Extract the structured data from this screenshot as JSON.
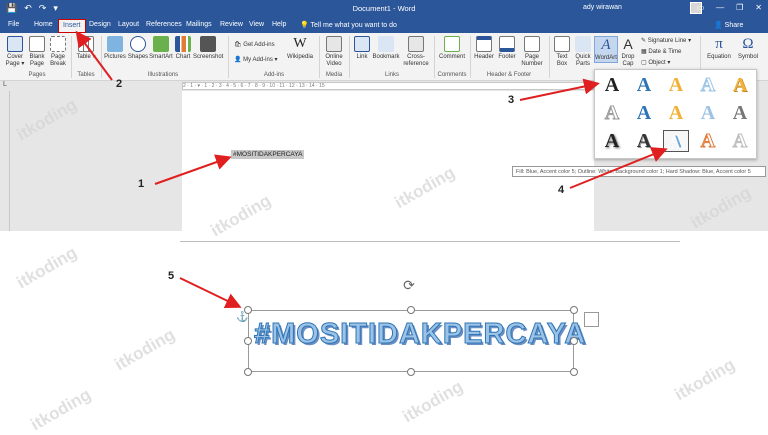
{
  "titlebar": {
    "quick_access": [
      "💾",
      "↶",
      "↷",
      "▾"
    ],
    "document_title": "Document1 - Word",
    "user_name": "ady wirawan",
    "controls": [
      "▭",
      "—",
      "❐",
      "✕"
    ]
  },
  "tabs": [
    {
      "label": "File"
    },
    {
      "label": "Home"
    },
    {
      "label": "Insert"
    },
    {
      "label": "Design"
    },
    {
      "label": "Layout"
    },
    {
      "label": "References"
    },
    {
      "label": "Mailings"
    },
    {
      "label": "Review"
    },
    {
      "label": "View"
    },
    {
      "label": "Help"
    }
  ],
  "tell_me": "Tell me what you want to do",
  "share_label": "Share",
  "ribbon": {
    "cover_page": "Cover Page ▾",
    "blank_page": "Blank Page",
    "page_break": "Page Break",
    "table": "Table ▾",
    "pictures": "Pictures",
    "shapes": "Shapes",
    "smartart": "SmartArt",
    "chart": "Chart",
    "screenshot": "Screenshot",
    "get_addins": "Get Add-ins",
    "my_addins": "My Add-ins",
    "wikipedia": "Wikipedia",
    "online_video": "Online Video",
    "link": "Link",
    "bookmark": "Bookmark",
    "cross_reference": "Cross-reference",
    "comment": "Comment",
    "header": "Header",
    "footer": "Footer",
    "page_number": "Page Number",
    "text_box": "Text Box",
    "quick_parts": "Quick Parts",
    "wordart": "WordArt",
    "drop_cap": "Drop Cap",
    "signature_line": "Signature Line",
    "date_time": "Date & Time",
    "object": "Object",
    "equation": "Equation",
    "symbol": "Symbol",
    "groups": {
      "pages": "Pages",
      "tables": "Tables",
      "illustrations": "Illustrations",
      "addins": "Add-ins",
      "media": "Media",
      "links": "Links",
      "comments": "Comments",
      "header_footer": "Header & Footer"
    }
  },
  "ruler_marks": "2 · 1 · ▾ · 1 · 2 · 3 · 4 · 5 · 6 · 7 · 8 · 9 · 10 · 11 · 12 · 13 · 14 · 15",
  "selected_text": "#MOSITIDAKPERCAYA",
  "tooltip": "Fill: Blue, Accent color 5; Outline: White, Background color 1; Hard Shadow: Blue, Accent color 5",
  "wordart_text": "#MOSITIDAKPERCAYA",
  "watermark": "itkoding",
  "steps": [
    "1",
    "2",
    "3",
    "4",
    "5"
  ],
  "colors": {
    "accent": "#2b579a",
    "arrow": "#e02020"
  }
}
